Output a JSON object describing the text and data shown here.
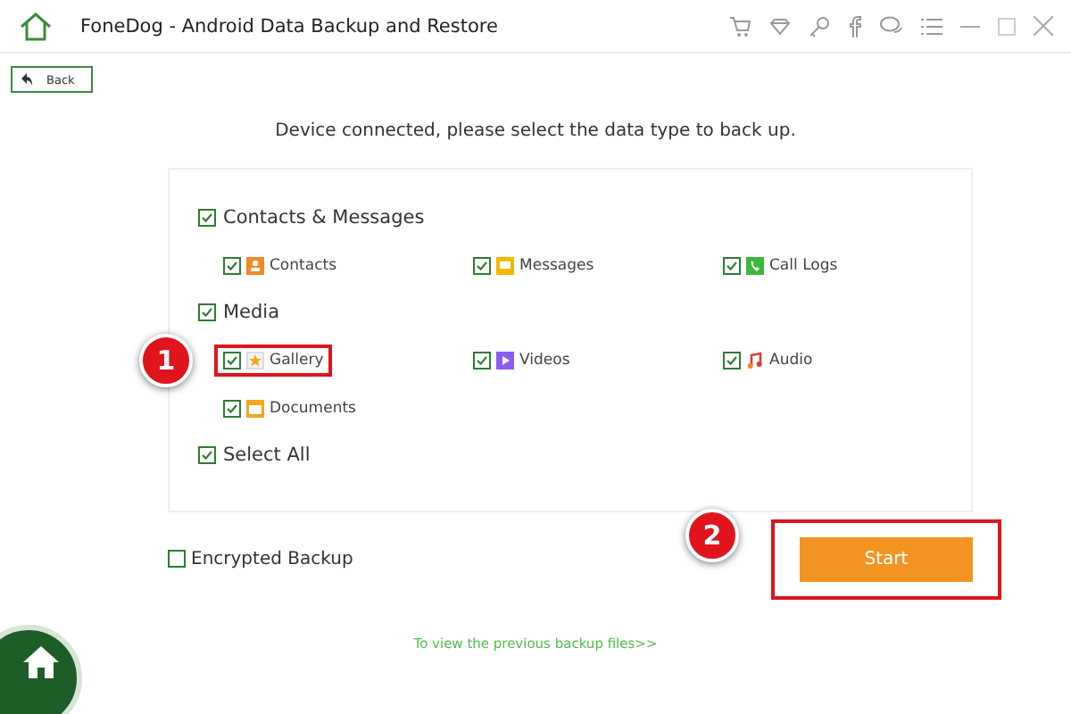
{
  "window": {
    "title": "FoneDog - Android Data Backup and Restore"
  },
  "back_button": "Back",
  "instruction": "Device connected, please select the data type to back up.",
  "groups": [
    {
      "label": "Contacts & Messages",
      "checked": true,
      "items": [
        {
          "label": "Contacts",
          "kind": "contacts",
          "checked": true,
          "highlighted": false
        },
        {
          "label": "Messages",
          "kind": "messages",
          "checked": true,
          "highlighted": false
        },
        {
          "label": "Call Logs",
          "kind": "call_logs",
          "checked": true,
          "highlighted": false
        }
      ]
    },
    {
      "label": "Media",
      "checked": true,
      "items": [
        {
          "label": "Gallery",
          "kind": "gallery",
          "checked": true,
          "highlighted": true,
          "callout": "1"
        },
        {
          "label": "Videos",
          "kind": "videos",
          "checked": true,
          "highlighted": false
        },
        {
          "label": "Audio",
          "kind": "audio",
          "checked": true,
          "highlighted": false
        },
        {
          "label": "Documents",
          "kind": "documents",
          "checked": true,
          "highlighted": false
        }
      ]
    }
  ],
  "select_all": {
    "label": "Select All",
    "checked": true
  },
  "encrypted_backup": {
    "label": "Encrypted Backup",
    "checked": false
  },
  "start_button": {
    "label": "Start",
    "highlighted": true,
    "callout": "2"
  },
  "previous_backups_link": "To view the previous backup files>>"
}
